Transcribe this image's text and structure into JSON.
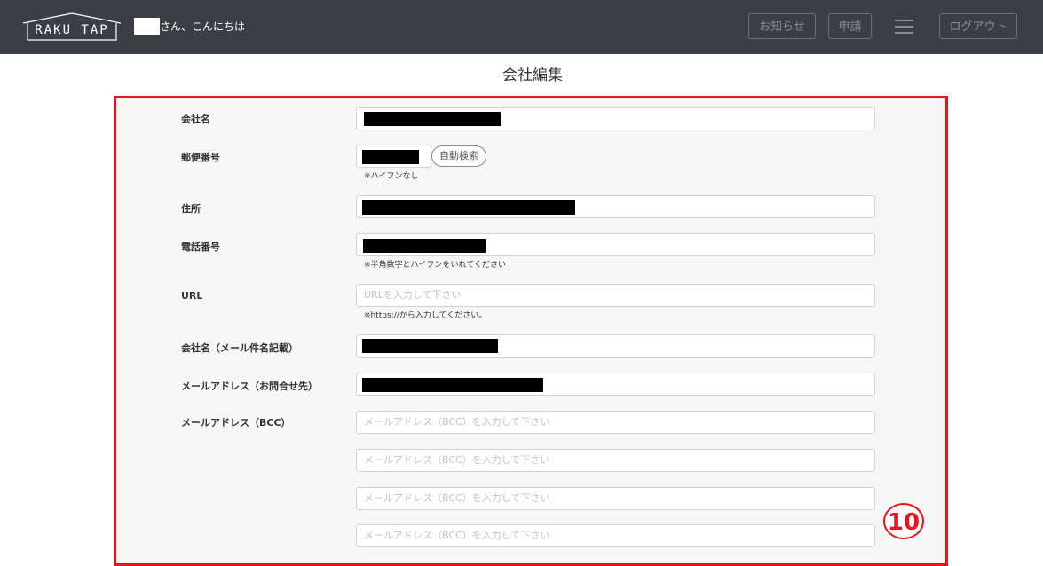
{
  "header": {
    "logo_text": "RAKU TAP",
    "greeting": "さん、こんにちは",
    "notice_label": "お知らせ",
    "apply_label": "申請",
    "logout_label": "ログアウト"
  },
  "page": {
    "title": "会社編集"
  },
  "form": {
    "company_name_label": "会社名",
    "zip_label": "郵便番号",
    "zip_button": "自動検索",
    "zip_hint": "※ハイフンなし",
    "address_label": "住所",
    "phone_label": "電話番号",
    "phone_hint": "※半角数字とハイフンをいれてください",
    "url_label": "URL",
    "url_placeholder": "URLを入力して下さい",
    "url_hint": "※https://から入力してください。",
    "mail_company_label": "会社名（メール件名記載）",
    "contact_email_label": "メールアドレス（お問合せ先）",
    "bcc_label": "メールアドレス（BCC）",
    "bcc_placeholder": "メールアドレス（BCC）を入力して下さい"
  },
  "annotation": {
    "number": "10"
  },
  "colors": {
    "header_bg": "#3b3e44",
    "highlight": "#e8141f",
    "panel_bg": "#f6f6f7"
  }
}
